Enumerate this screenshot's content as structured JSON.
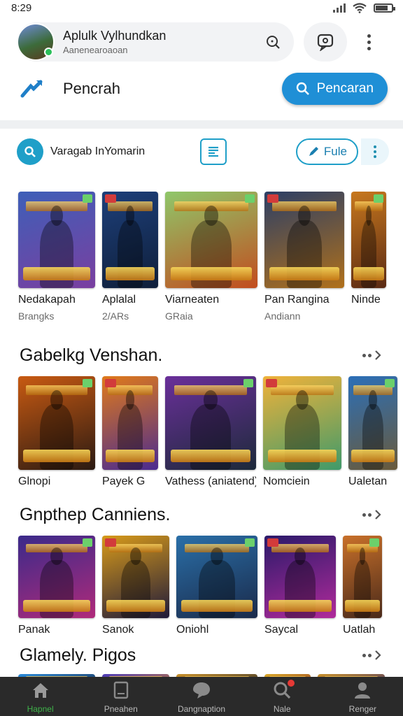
{
  "status_bar": {
    "time": "8:29"
  },
  "header": {
    "name": "Aplulk Vylhundkan",
    "subtitle": "Aanenearoaoan"
  },
  "title_row": {
    "title": "Pencrah",
    "search_button_label": "Pencaran"
  },
  "filter_row": {
    "query": "Varagab InYomarin",
    "filter_button_label": "Fule"
  },
  "row1": {
    "cards": [
      {
        "title": "Nedakapah",
        "sub": "Brangks",
        "colors": [
          "#3e5fb8",
          "#7a3fa0"
        ]
      },
      {
        "title": "Aplalal",
        "sub": "2/ARs",
        "colors": [
          "#1d3f7a",
          "#0f1f3a"
        ]
      },
      {
        "title": "Viarneaten",
        "sub": "GRaia",
        "colors": [
          "#8fc76a",
          "#c24c1e"
        ]
      },
      {
        "title": "Pan Rangina",
        "sub": "Andiann",
        "colors": [
          "#2c3f66",
          "#b0701a"
        ]
      },
      {
        "title": "Ninde",
        "sub": "",
        "colors": [
          "#c7781e",
          "#5a2a14"
        ]
      }
    ]
  },
  "section2": {
    "title": "Gabelkg Venshan.",
    "cards": [
      {
        "title": "Glnopi",
        "colors": [
          "#c85a12",
          "#2b1a12"
        ]
      },
      {
        "title": "Payek G",
        "colors": [
          "#e07a1a",
          "#4a2a90"
        ]
      },
      {
        "title": "Vathess (aniatend)",
        "colors": [
          "#6a2f9a",
          "#1d2a3a"
        ]
      },
      {
        "title": "Nomciein",
        "colors": [
          "#f0b23a",
          "#3f9a6a"
        ]
      },
      {
        "title": "Ualetan",
        "colors": [
          "#2b6fb8",
          "#6a5a3a"
        ]
      }
    ]
  },
  "section3": {
    "title": "Gnpthep Canniens.",
    "cards": [
      {
        "title": "Panak",
        "colors": [
          "#3a2a8a",
          "#b02a7a"
        ]
      },
      {
        "title": "Sanok",
        "colors": [
          "#d79a1a",
          "#1f1a3a"
        ]
      },
      {
        "title": "Oniohl",
        "colors": [
          "#2a6fa8",
          "#1a2a4a"
        ]
      },
      {
        "title": "Saycal",
        "colors": [
          "#2a1a6a",
          "#b02a9a"
        ]
      },
      {
        "title": "Uatlah",
        "colors": [
          "#c8702a",
          "#4a2a1a"
        ]
      }
    ]
  },
  "section4": {
    "title": "Glamely. Pigos",
    "cards": [
      {
        "colors": [
          "#2a8ad8",
          "#1a2a4a"
        ]
      },
      {
        "colors": [
          "#4a3ab8",
          "#d0802a"
        ]
      },
      {
        "colors": [
          "#c8902a",
          "#2a2a2a"
        ]
      },
      {
        "colors": [
          "#d8a82a",
          "#8a2a1a"
        ]
      },
      {
        "colors": [
          "#c8902a",
          "#3a2a6a"
        ]
      }
    ]
  },
  "bottom_nav": {
    "items": [
      {
        "label": "Hapnel",
        "icon": "home-icon",
        "active": true
      },
      {
        "label": "Pneahen",
        "icon": "book-icon",
        "active": false
      },
      {
        "label": "Dangnaption",
        "icon": "chat-icon",
        "active": false
      },
      {
        "label": "Nale",
        "icon": "search-icon",
        "active": false,
        "badge": true
      },
      {
        "label": "Renger",
        "icon": "profile-icon",
        "active": false
      }
    ]
  }
}
